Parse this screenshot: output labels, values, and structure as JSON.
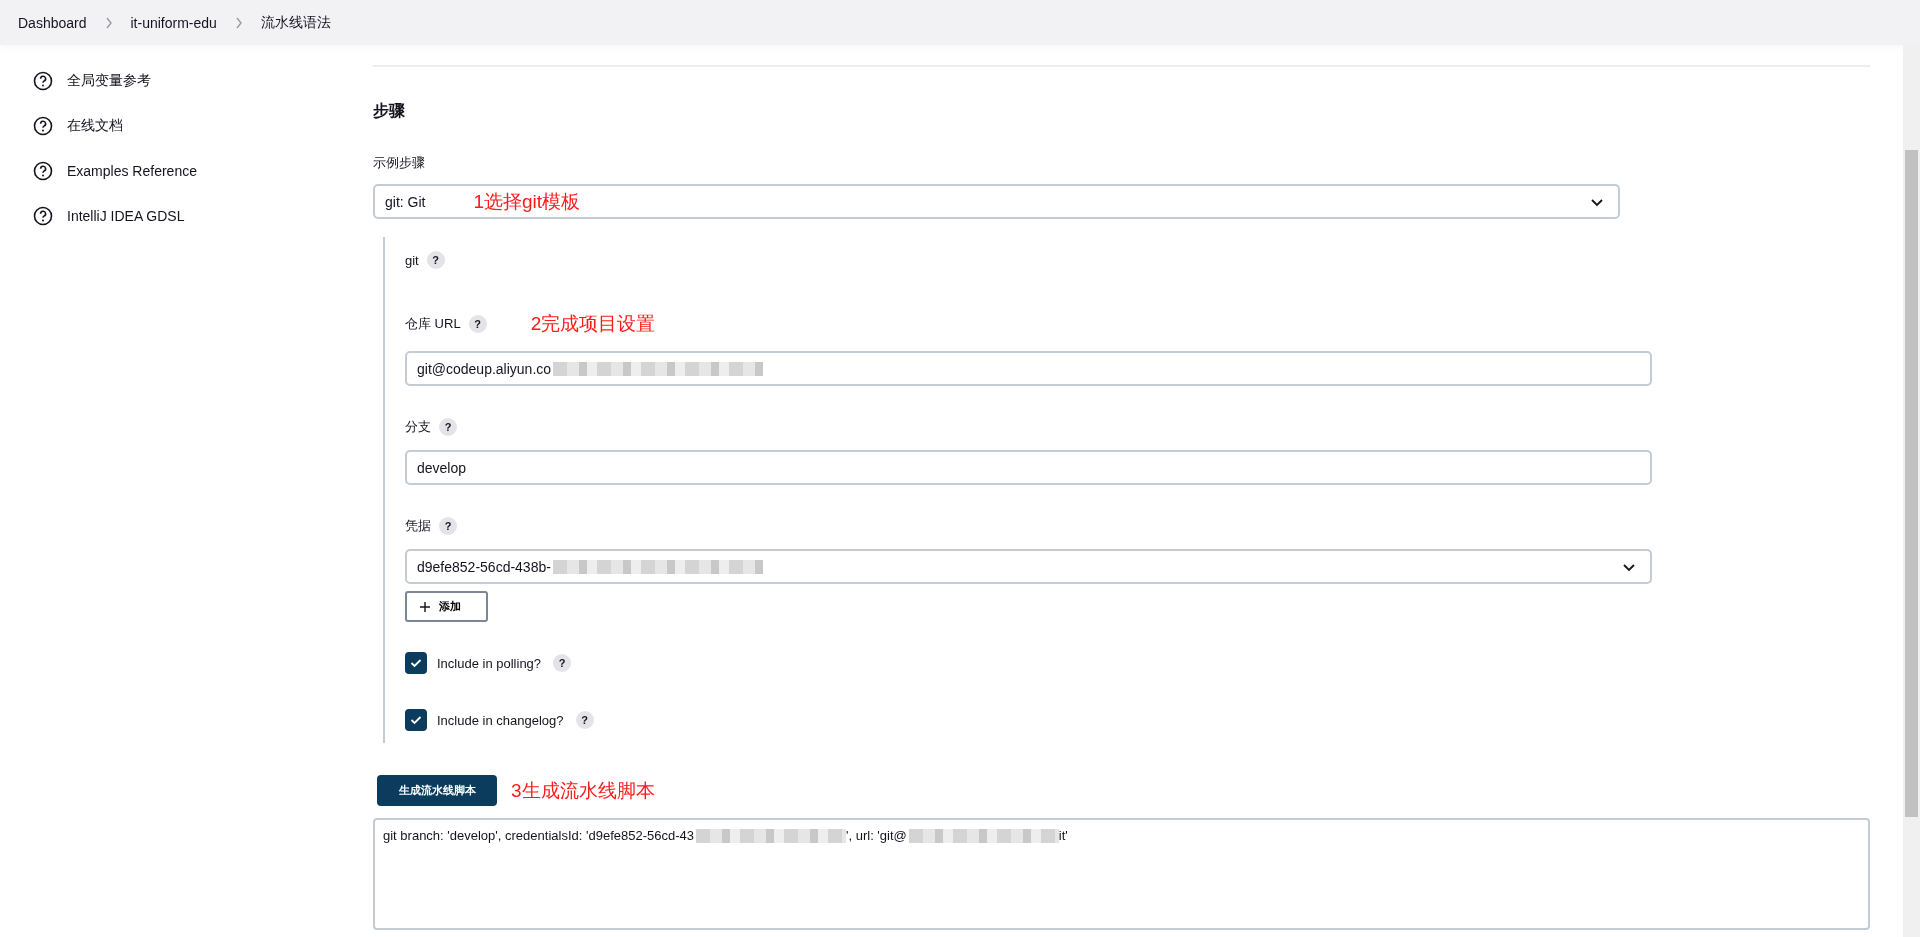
{
  "breadcrumbs": [
    "Dashboard",
    "it-uniform-edu",
    "流水线语法"
  ],
  "sidebar": {
    "items": [
      {
        "label": "全局变量参考"
      },
      {
        "label": "在线文档"
      },
      {
        "label": "Examples Reference"
      },
      {
        "label": "IntelliJ IDEA GDSL"
      }
    ]
  },
  "section_title": "步骤",
  "sample_step": {
    "label": "示例步骤",
    "value": "git: Git",
    "annotation": "1选择git模板"
  },
  "step": {
    "title": "git",
    "help": "?",
    "fields": [
      {
        "kind": "text",
        "label": "仓库 URL",
        "help": "?",
        "annotation": "2完成项目设置",
        "value": "git@codeup.aliyun.co",
        "redacted": true
      },
      {
        "kind": "text",
        "label": "分支",
        "help": "?",
        "value": "develop",
        "redacted": false
      },
      {
        "kind": "select",
        "label": "凭据",
        "help": "?",
        "value": "d9efe852-56cd-438b-",
        "redacted": true,
        "add_button": "添加"
      }
    ],
    "checkboxes": [
      {
        "label": "Include in polling?",
        "help": "?",
        "checked": true
      },
      {
        "label": "Include in changelog?",
        "help": "?",
        "checked": true
      }
    ]
  },
  "generate_button": {
    "label": "生成流水线脚本",
    "annotation": "3生成流水线脚本"
  },
  "output": {
    "segments": [
      {
        "kind": "text",
        "text": "git branch: 'develop', credentialsId: 'd9efe852-56cd-43"
      },
      {
        "kind": "redacted"
      },
      {
        "kind": "text",
        "text": "', url: 'git@"
      },
      {
        "kind": "redacted"
      },
      {
        "kind": "text",
        "text": "it'"
      }
    ]
  }
}
